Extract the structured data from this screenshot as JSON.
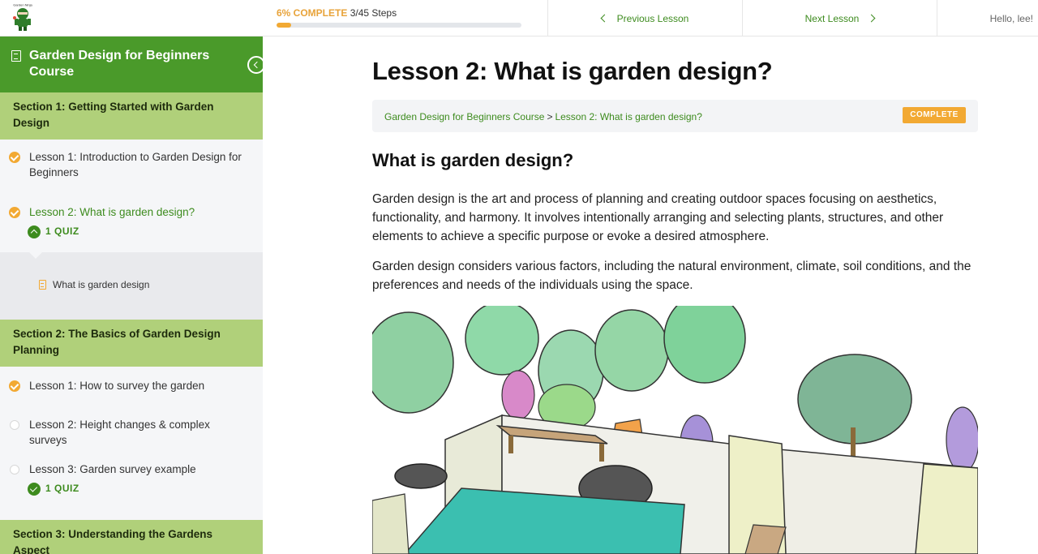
{
  "header": {
    "logo_label": "Garden Ninja",
    "progress_percent_text": "6% COMPLETE",
    "progress_steps_text": "3/45 Steps",
    "progress_fraction": 0.06,
    "prev_label": "Previous Lesson",
    "next_label": "Next Lesson",
    "greeting": "Hello, lee!"
  },
  "sidebar": {
    "course_title": "Garden Design for Beginners Course",
    "sections": [
      {
        "title": "Section 1: Getting Started with Garden Design",
        "lessons": [
          {
            "label": "Lesson 1: Introduction to Garden Design for Beginners",
            "status": "complete"
          },
          {
            "label": "Lesson 2: What is garden design?",
            "status": "complete",
            "current": true,
            "quiz_label": "1 QUIZ",
            "quiz_items": [
              "What is garden design"
            ]
          }
        ]
      },
      {
        "title": "Section 2: The Basics of Garden Design Planning",
        "lessons": [
          {
            "label": "Lesson 1: How to survey the garden",
            "status": "complete"
          },
          {
            "label": "Lesson 2: Height changes & complex surveys",
            "status": "incomplete"
          },
          {
            "label": "Lesson 3: Garden survey example",
            "status": "incomplete",
            "quiz_label": "1 QUIZ"
          }
        ]
      },
      {
        "title": "Section 3: Understanding the Gardens Aspect"
      }
    ]
  },
  "main": {
    "title": "Lesson 2: What is garden design?",
    "breadcrumb": [
      "Garden Design for Beginners Course",
      "Lesson 2: What is garden design?"
    ],
    "breadcrumb_sep": ">",
    "status_badge": "COMPLETE",
    "subheading": "What is garden design?",
    "paragraphs": [
      "Garden design is the art and process of planning and creating outdoor spaces focusing on aesthetics, functionality, and harmony. It involves intentionally arranging and selecting plants, structures, and other elements to achieve a specific purpose or evoke a desired atmosphere.",
      "Garden design considers various factors, including the natural environment, climate, soil conditions, and the preferences and needs of the individuals using the space."
    ]
  },
  "colors": {
    "brand_green": "#4a9a2a",
    "section_green": "#b0d07a",
    "accent_orange": "#f2a933",
    "link_green": "#3d8b1e"
  }
}
